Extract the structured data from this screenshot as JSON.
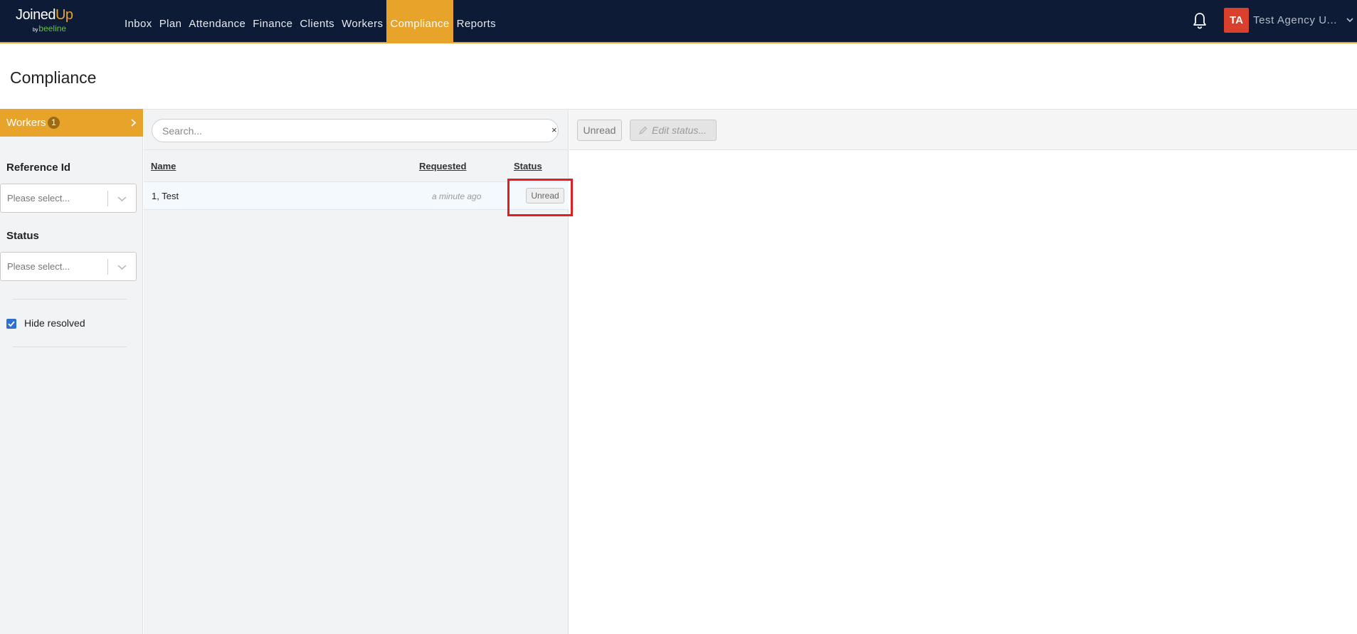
{
  "app": {
    "logo_main": "Joined",
    "logo_up": "Up",
    "logo_by": "by",
    "logo_sub": "beeline"
  },
  "nav": {
    "items": [
      {
        "label": "Inbox"
      },
      {
        "label": "Plan"
      },
      {
        "label": "Attendance"
      },
      {
        "label": "Finance"
      },
      {
        "label": "Clients"
      },
      {
        "label": "Workers"
      },
      {
        "label": "Compliance",
        "active": true
      },
      {
        "label": "Reports"
      }
    ]
  },
  "header": {
    "notification_icon": "bell-icon",
    "avatar_initials": "TA",
    "user_name": "Test Agency U...",
    "avatar_color": "#d9412c"
  },
  "page": {
    "title": "Compliance"
  },
  "sidebar": {
    "workers_label": "Workers",
    "workers_count": "1",
    "filters": {
      "reference_label": "Reference Id",
      "reference_placeholder": "Please select...",
      "status_label": "Status",
      "status_placeholder": "Please select..."
    },
    "hide_resolved_label": "Hide resolved",
    "hide_resolved_checked": true
  },
  "list": {
    "search_placeholder": "Search...",
    "search_clear": "×",
    "columns": {
      "name": "Name",
      "requested": "Requested",
      "status": "Status"
    },
    "rows": [
      {
        "name": "1, Test",
        "requested": "a minute ago",
        "status": "Unread"
      }
    ]
  },
  "detail": {
    "unread_label": "Unread",
    "edit_status_label": "Edit status..."
  },
  "colors": {
    "nav_bg": "#0d1b36",
    "accent": "#e8a32b",
    "highlight": "#e02020"
  }
}
